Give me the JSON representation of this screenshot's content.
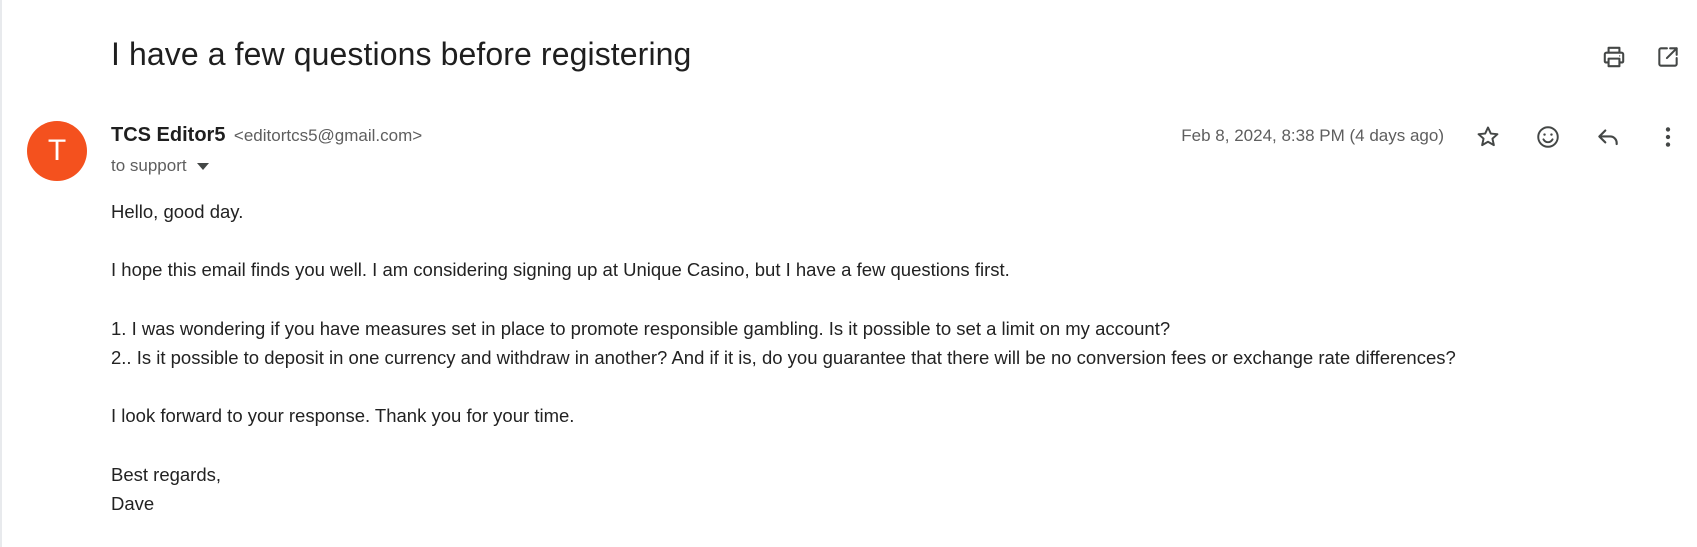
{
  "email": {
    "subject": "I have a few questions before registering",
    "sender": {
      "avatar_letter": "T",
      "avatar_color": "#f4511e",
      "name": "TCS Editor5",
      "email": "<editortcs5@gmail.com>"
    },
    "recipient": "to support",
    "date": "Feb 8, 2024, 8:38 PM (4 days ago)",
    "body": {
      "greeting": "Hello, good day.",
      "intro": "I hope this email finds you well. I am considering signing up at Unique Casino, but I have a few questions first.",
      "question_1": "1. I was wondering if you have measures set in place to promote responsible gambling. Is it possible to set a limit on my account?",
      "question_2": "2.. Is it possible to deposit in one currency and withdraw in another? And if it is, do you guarantee that there will be no conversion fees or exchange rate differences?",
      "closing": "I look forward to your response. Thank you for your time.",
      "signoff": "Best regards,",
      "signature": "Dave"
    }
  },
  "icons": {
    "print": "print-icon",
    "open_new_window": "open-in-new-window-icon",
    "star": "star-icon",
    "emoji": "emoji-reaction-icon",
    "reply": "reply-icon",
    "more": "more-vertical-icon"
  }
}
